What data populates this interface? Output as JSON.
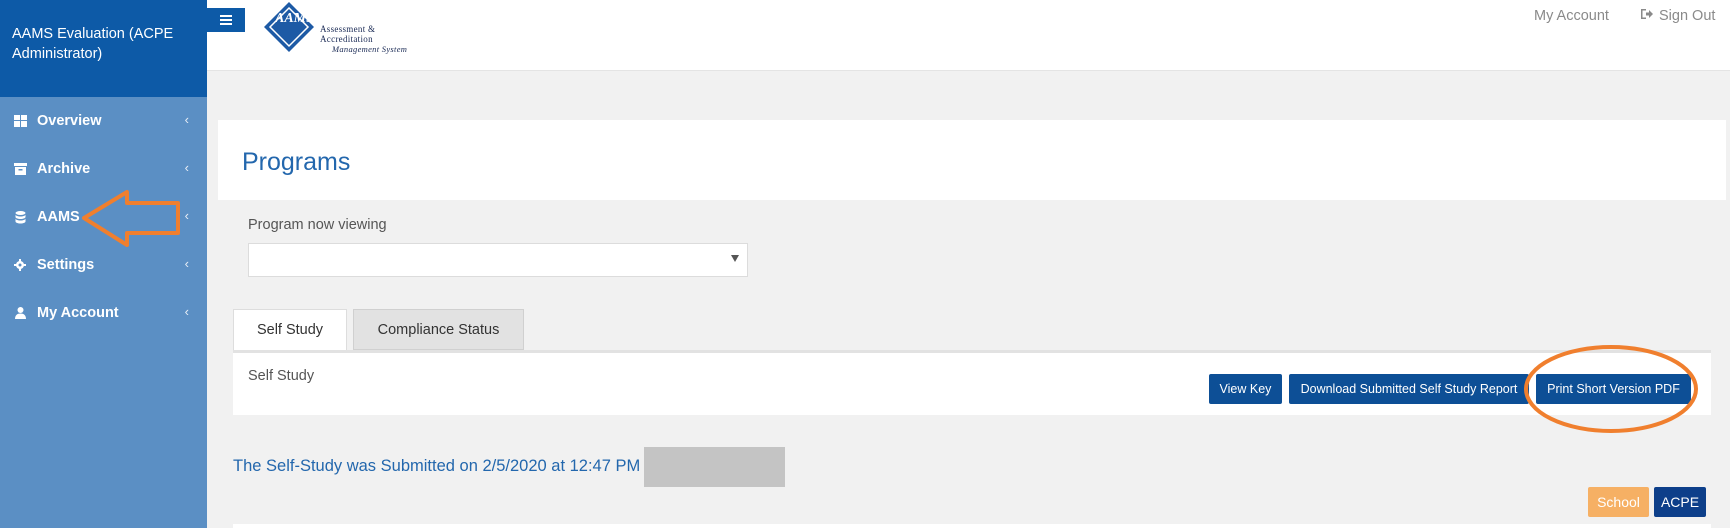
{
  "sidebar": {
    "title": "AAMS Evaluation (ACPE Administrator)",
    "items": [
      {
        "label": "Overview",
        "icon": "dashboard-icon"
      },
      {
        "label": "Archive",
        "icon": "archive-icon"
      },
      {
        "label": "AAMS",
        "icon": "database-icon"
      },
      {
        "label": "Settings",
        "icon": "gear-icon"
      },
      {
        "label": "My Account",
        "icon": "user-icon"
      }
    ],
    "chevron": "‹"
  },
  "header": {
    "logo": {
      "mark": "AAMS",
      "line1": "Assessment &",
      "line2": "Accreditation",
      "line3": "Management System"
    },
    "my_account": "My Account",
    "sign_out": "Sign Out"
  },
  "page": {
    "title": "Programs",
    "program_label": "Program now viewing",
    "program_value": ""
  },
  "tabs": [
    "Self Study",
    "Compliance Status"
  ],
  "self_study": {
    "title": "Self Study",
    "buttons": {
      "view_key": "View Key",
      "download": "Download Submitted Self Study Report",
      "print": "Print Short Version PDF"
    },
    "submitted_text": "The Self-Study was Submitted on 2/5/2020 at 12:47 PM"
  },
  "badges": {
    "school": "School",
    "acpe": "ACPE"
  },
  "colors": {
    "sidebar": "#5b8fc4",
    "sidebar_header": "#0d5aa7",
    "primary_button": "#0d4f96",
    "annotation": "#f07f2e",
    "school_badge": "#f6b064",
    "acpe_badge": "#0d3f8a"
  }
}
